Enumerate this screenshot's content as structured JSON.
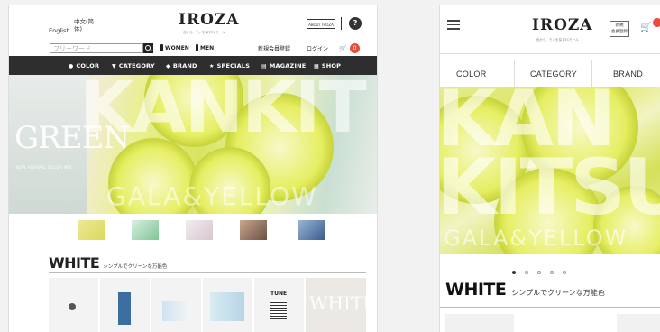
{
  "desktop": {
    "header": {
      "lang_en": "English",
      "lang_zh": "中文(简体)",
      "logo": "IROZA",
      "logo_sub": "色から、モノを探すECモール",
      "about_label": "ABOUT IROZA",
      "help_glyph": "?"
    },
    "search": {
      "placeholder": "フリーワード",
      "women_label": "WOMEN",
      "men_label": "MEN",
      "register_label": "新規会員登録",
      "login_label": "ログイン",
      "cart_count": "0"
    },
    "nav": {
      "items": [
        {
          "label": "COLOR",
          "icon": "palette-icon",
          "glyph": "●"
        },
        {
          "label": "CATEGORY",
          "icon": "shirt-icon",
          "glyph": "▼"
        },
        {
          "label": "BRAND",
          "icon": "tag-icon",
          "glyph": "◆"
        },
        {
          "label": "SPECIALS",
          "icon": "star-icon",
          "glyph": "★"
        },
        {
          "label": "MAGAZINE",
          "icon": "book-icon",
          "glyph": "▤"
        },
        {
          "label": "SHOP",
          "icon": "store-icon",
          "glyph": "▦"
        }
      ]
    },
    "hero": {
      "big_text": "KANKIT",
      "left_word": "GREEN",
      "left_sub": "NEW ARRIVAL COLOR MIX",
      "bottom_text": "GALA&YELLOW"
    },
    "section": {
      "title": "WHITE",
      "subtitle": "シンプルでクリーンな万能色"
    },
    "product_labels": {
      "tune": "TUNE",
      "white": "WHITE"
    }
  },
  "mobile": {
    "header": {
      "logo": "IROZA",
      "logo_sub": "色から、モノを探すECモール",
      "register_label": "新規\n会員登録"
    },
    "tabs": [
      "COLOR",
      "CATEGORY",
      "BRAND"
    ],
    "hero": {
      "line1": "KAN",
      "line2": "KITSU",
      "bottom_text": "GALA&YELLOW"
    },
    "section": {
      "title": "WHITE",
      "subtitle": "シンプルでクリーンな万能色"
    },
    "carousel_dots": 5,
    "active_dot": 0
  }
}
